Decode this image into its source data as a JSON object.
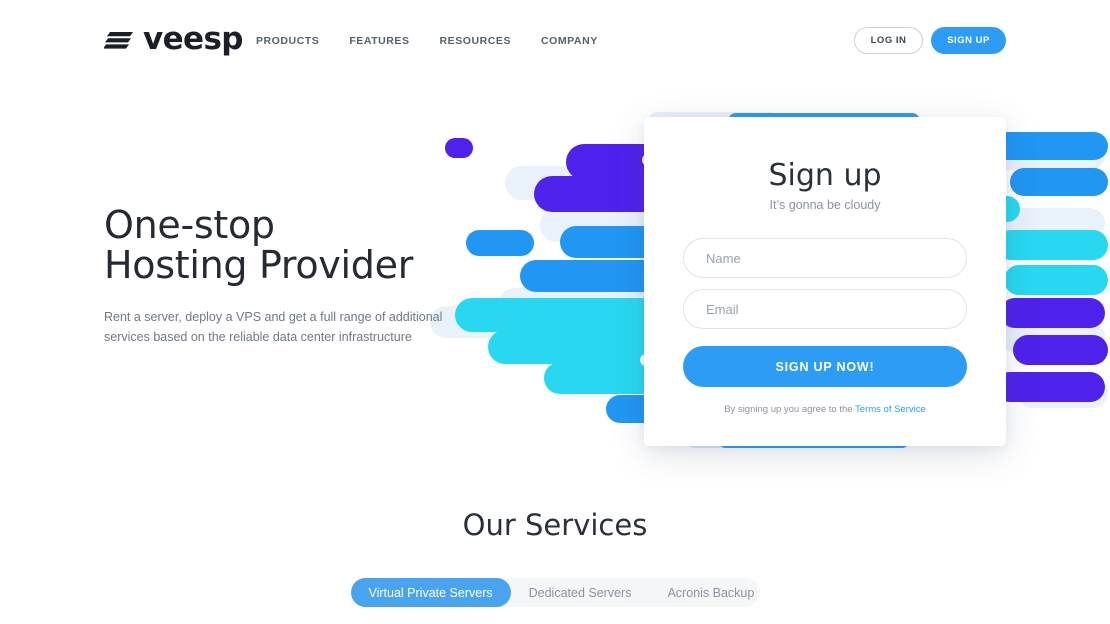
{
  "brand": {
    "name": "veesp",
    "logo_icon": "slanted-bars-icon"
  },
  "header": {
    "nav": [
      {
        "label": "PRODUCTS"
      },
      {
        "label": "FEATURES"
      },
      {
        "label": "RESOURCES"
      },
      {
        "label": "COMPANY"
      }
    ],
    "login_label": "LOG IN",
    "signup_label": "SIGN UP"
  },
  "hero": {
    "title_line1": "One-stop",
    "title_line2": "Hosting Provider",
    "subtitle": "Rent a server, deploy a VPS and get a full range of additional services based on the reliable data center infrastructure"
  },
  "signup_card": {
    "title": "Sign up",
    "subtitle": "It’s gonna be cloudy",
    "name_placeholder": "Name",
    "name_value": "",
    "email_placeholder": "Email",
    "email_value": "",
    "cta_label": "SIGN UP NOW!",
    "terms_prefix": "By signing up you agree to the ",
    "terms_link": "Terms of Service"
  },
  "services": {
    "title": "Our Services",
    "tabs": [
      {
        "label": "Virtual Private Servers",
        "active": true
      },
      {
        "label": "Dedicated Servers",
        "active": false
      },
      {
        "label": "Acronis Backup",
        "active": false
      }
    ]
  },
  "colors": {
    "accent_blue": "#2d9cf5",
    "tab_active_blue": "#4aa3ef",
    "illustration_purple": "#4f22ec",
    "illustration_blue": "#2196f3",
    "illustration_cyan": "#28d8f0",
    "illustration_pale": "#e9f1fb",
    "text_dark": "#2b313a",
    "text_muted": "#8b939f",
    "nav_text": "#55606e"
  }
}
